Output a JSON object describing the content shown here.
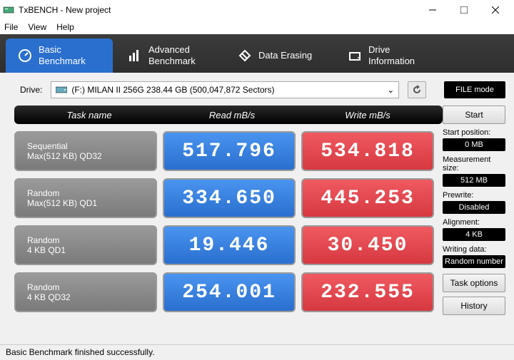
{
  "window": {
    "title": "TxBENCH - New project"
  },
  "menu": {
    "file": "File",
    "view": "View",
    "help": "Help"
  },
  "tabs": {
    "basic": "Basic\nBenchmark",
    "advanced": "Advanced\nBenchmark",
    "erasing": "Data Erasing",
    "drive": "Drive\nInformation"
  },
  "drive": {
    "label": "Drive:",
    "value": "(F:) MILAN II 256G  238.44 GB (500,047,872 Sectors)",
    "file_mode": "FILE mode"
  },
  "table": {
    "headers": {
      "task": "Task name",
      "read": "Read mB/s",
      "write": "Write mB/s"
    },
    "rows": [
      {
        "name1": "Sequential",
        "name2": "Max(512 KB) QD32",
        "read": "517.796",
        "write": "534.818"
      },
      {
        "name1": "Random",
        "name2": "Max(512 KB) QD1",
        "read": "334.650",
        "write": "445.253"
      },
      {
        "name1": "Random",
        "name2": "4 KB QD1",
        "read": "19.446",
        "write": "30.450"
      },
      {
        "name1": "Random",
        "name2": "4 KB QD32",
        "read": "254.001",
        "write": "232.555"
      }
    ]
  },
  "side": {
    "start": "Start",
    "start_pos_label": "Start position:",
    "start_pos_val": "0 MB",
    "meas_label": "Measurement size:",
    "meas_val": "512 MB",
    "prewrite_label": "Prewrite:",
    "prewrite_val": "Disabled",
    "align_label": "Alignment:",
    "align_val": "4 KB",
    "wdata_label": "Writing data:",
    "wdata_val": "Random number",
    "task_options": "Task options",
    "history": "History"
  },
  "status": "Basic Benchmark finished successfully.",
  "chart_data": {
    "type": "table",
    "title": "TxBENCH Basic Benchmark",
    "columns": [
      "Task",
      "Read MB/s",
      "Write MB/s"
    ],
    "rows": [
      [
        "Sequential Max(512 KB) QD32",
        517.796,
        534.818
      ],
      [
        "Random Max(512 KB) QD1",
        334.65,
        445.253
      ],
      [
        "Random 4 KB QD1",
        19.446,
        30.45
      ],
      [
        "Random 4 KB QD32",
        254.001,
        232.555
      ]
    ]
  }
}
